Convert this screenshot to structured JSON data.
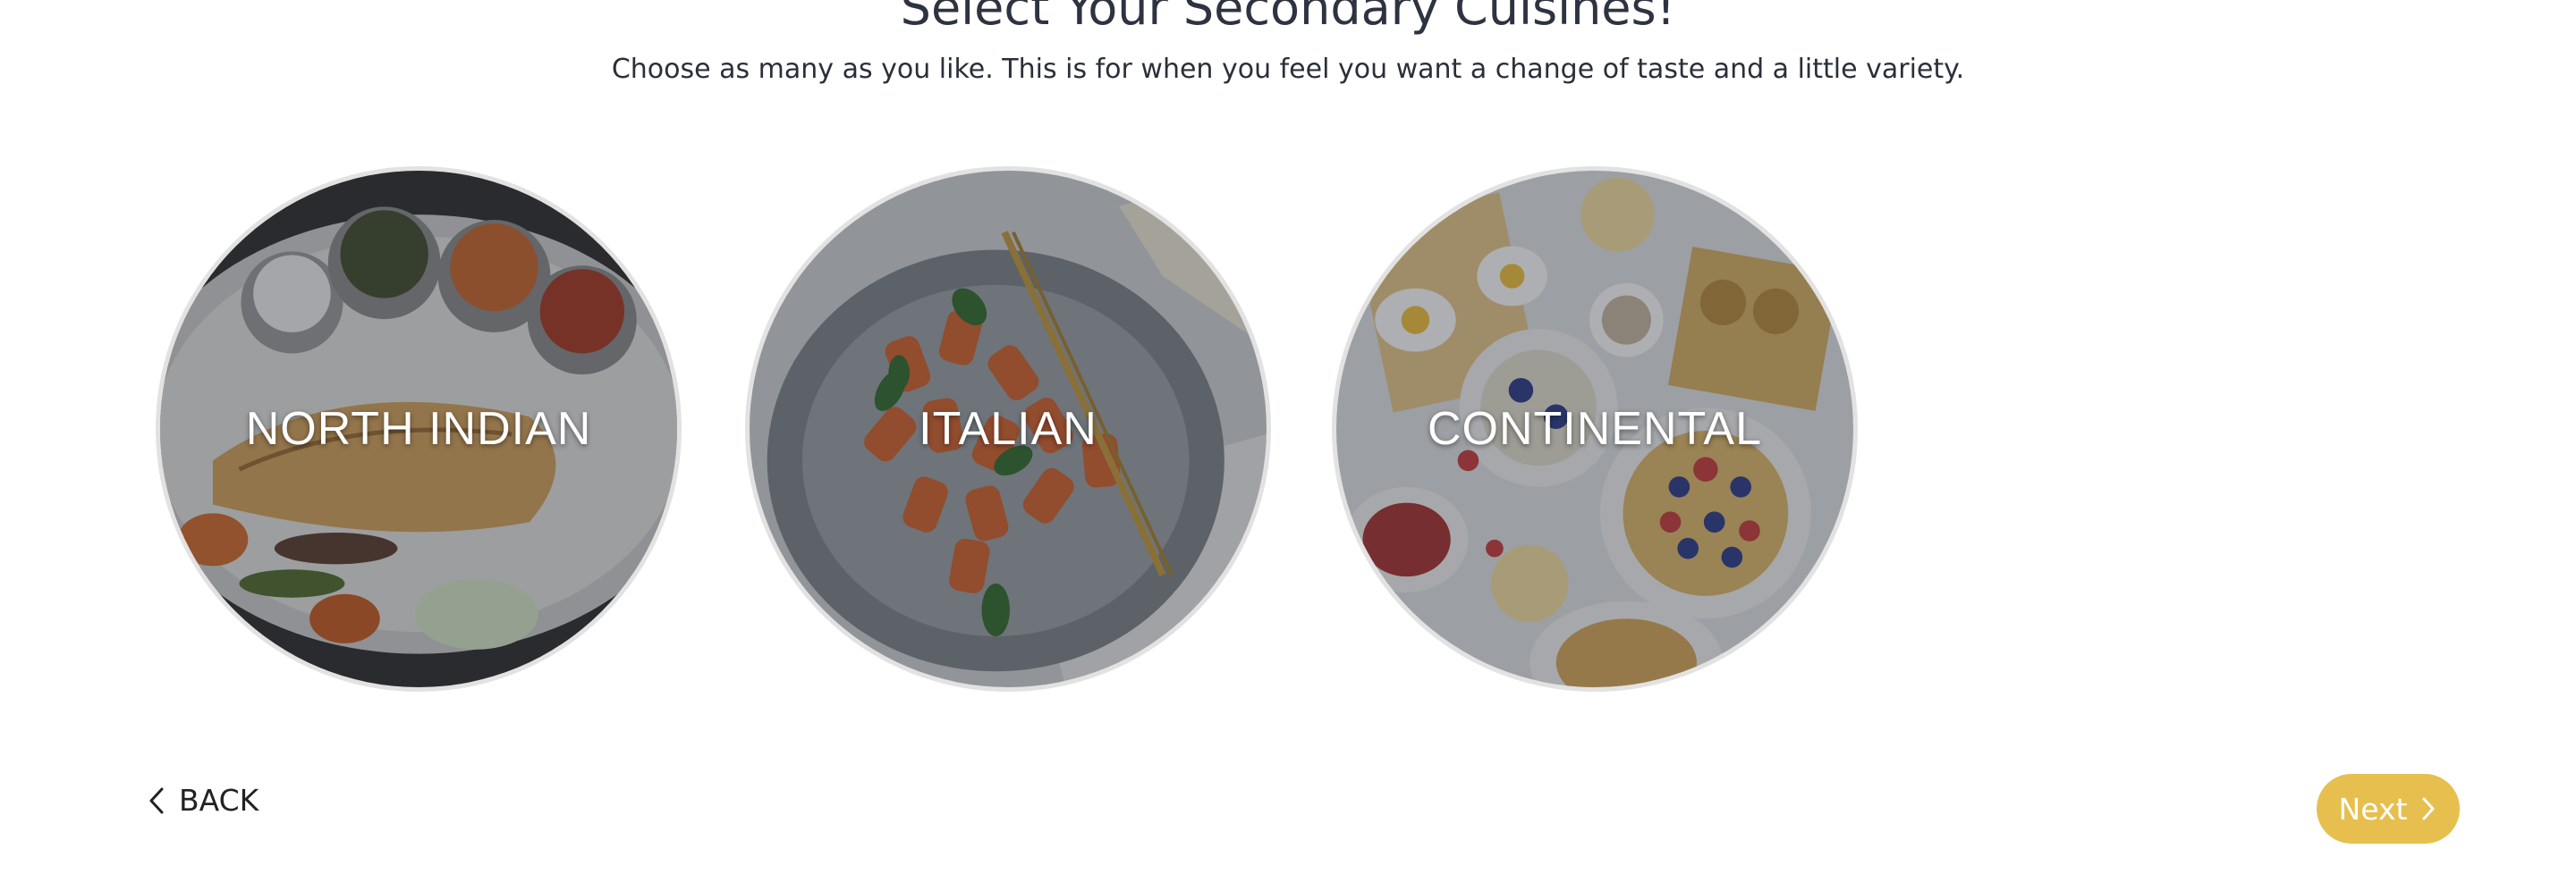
{
  "header": {
    "title": "Select Your Secondary Cuisines!",
    "subtitle": "Choose as many as you like. This is for when you feel you want a change of taste and a little variety."
  },
  "cuisines": [
    {
      "label": "NORTH INDIAN",
      "selected": false
    },
    {
      "label": "ITALIAN",
      "selected": false
    },
    {
      "label": "CONTINENTAL",
      "selected": false
    }
  ],
  "nav": {
    "back_label": "BACK",
    "next_label": "Next"
  },
  "colors": {
    "accent": "#e6bf4e",
    "text": "#2d3340",
    "card_border": "#e2e2e2"
  },
  "icons": {
    "back": "chevron-left-icon",
    "next": "chevron-right-icon"
  }
}
